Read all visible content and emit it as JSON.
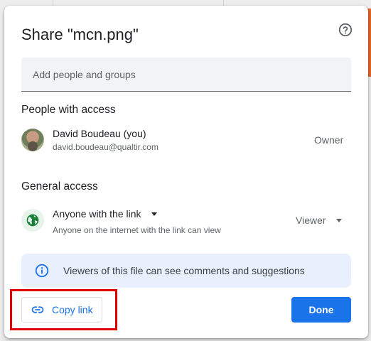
{
  "dialog": {
    "title": "Share \"mcn.png\"",
    "help_icon": "help-circle-icon"
  },
  "add_people": {
    "placeholder": "Add people and groups",
    "value": ""
  },
  "people_section": {
    "heading": "People with access",
    "people": [
      {
        "name": "David Boudeau (you)",
        "email": "david.boudeau@qualtir.com",
        "role": "Owner"
      }
    ]
  },
  "general_access": {
    "heading": "General access",
    "type": "Anyone with the link",
    "description": "Anyone on the internet with the link can view",
    "role": "Viewer",
    "globe_icon": "globe-icon"
  },
  "info_banner": {
    "text": "Viewers of this file can see comments and suggestions",
    "icon": "info-icon"
  },
  "footer": {
    "copy_link_label": "Copy link",
    "done_label": "Done"
  },
  "colors": {
    "accent": "#1a73e8",
    "highlight": "#e00000",
    "banner_bg": "#e8f0fe",
    "globe_green": "#188038"
  }
}
